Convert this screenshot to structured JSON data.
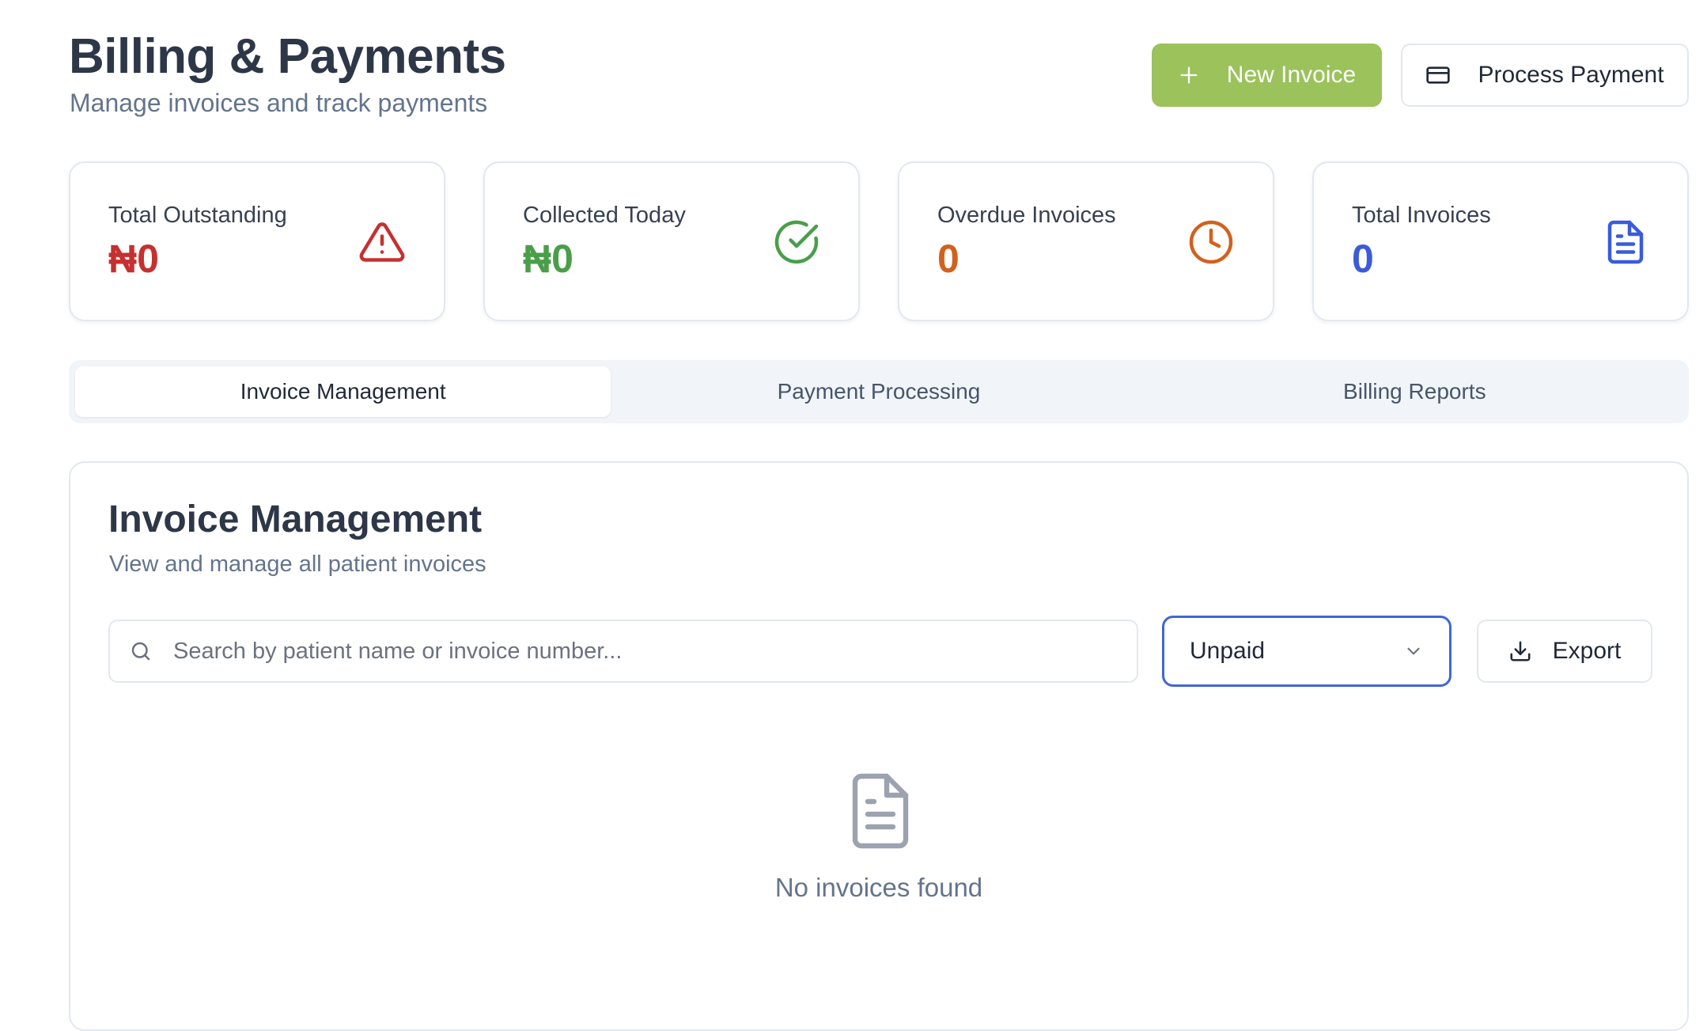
{
  "header": {
    "title": "Billing & Payments",
    "subtitle": "Manage invoices and track payments",
    "new_invoice_label": "New Invoice",
    "process_payment_label": "Process Payment"
  },
  "stats": [
    {
      "label": "Total Outstanding",
      "value": "₦0",
      "color": "#c53030",
      "icon": "alert-triangle-icon"
    },
    {
      "label": "Collected Today",
      "value": "₦0",
      "color": "#4a9e4a",
      "icon": "check-circle-icon"
    },
    {
      "label": "Overdue Invoices",
      "value": "0",
      "color": "#d1611f",
      "icon": "clock-icon"
    },
    {
      "label": "Total Invoices",
      "value": "0",
      "color": "#3b5bdb",
      "icon": "document-icon"
    }
  ],
  "tabs": [
    {
      "label": "Invoice Management",
      "active": true
    },
    {
      "label": "Payment Processing",
      "active": false
    },
    {
      "label": "Billing Reports",
      "active": false
    }
  ],
  "panel": {
    "title": "Invoice Management",
    "subtitle": "View and manage all patient invoices",
    "search_placeholder": "Search by patient name or invoice number...",
    "search_value": "",
    "status_filter": "Unpaid",
    "export_label": "Export",
    "empty_message": "No invoices found"
  },
  "colors": {
    "accent": "#9bc25b",
    "focus": "#4166d5"
  }
}
